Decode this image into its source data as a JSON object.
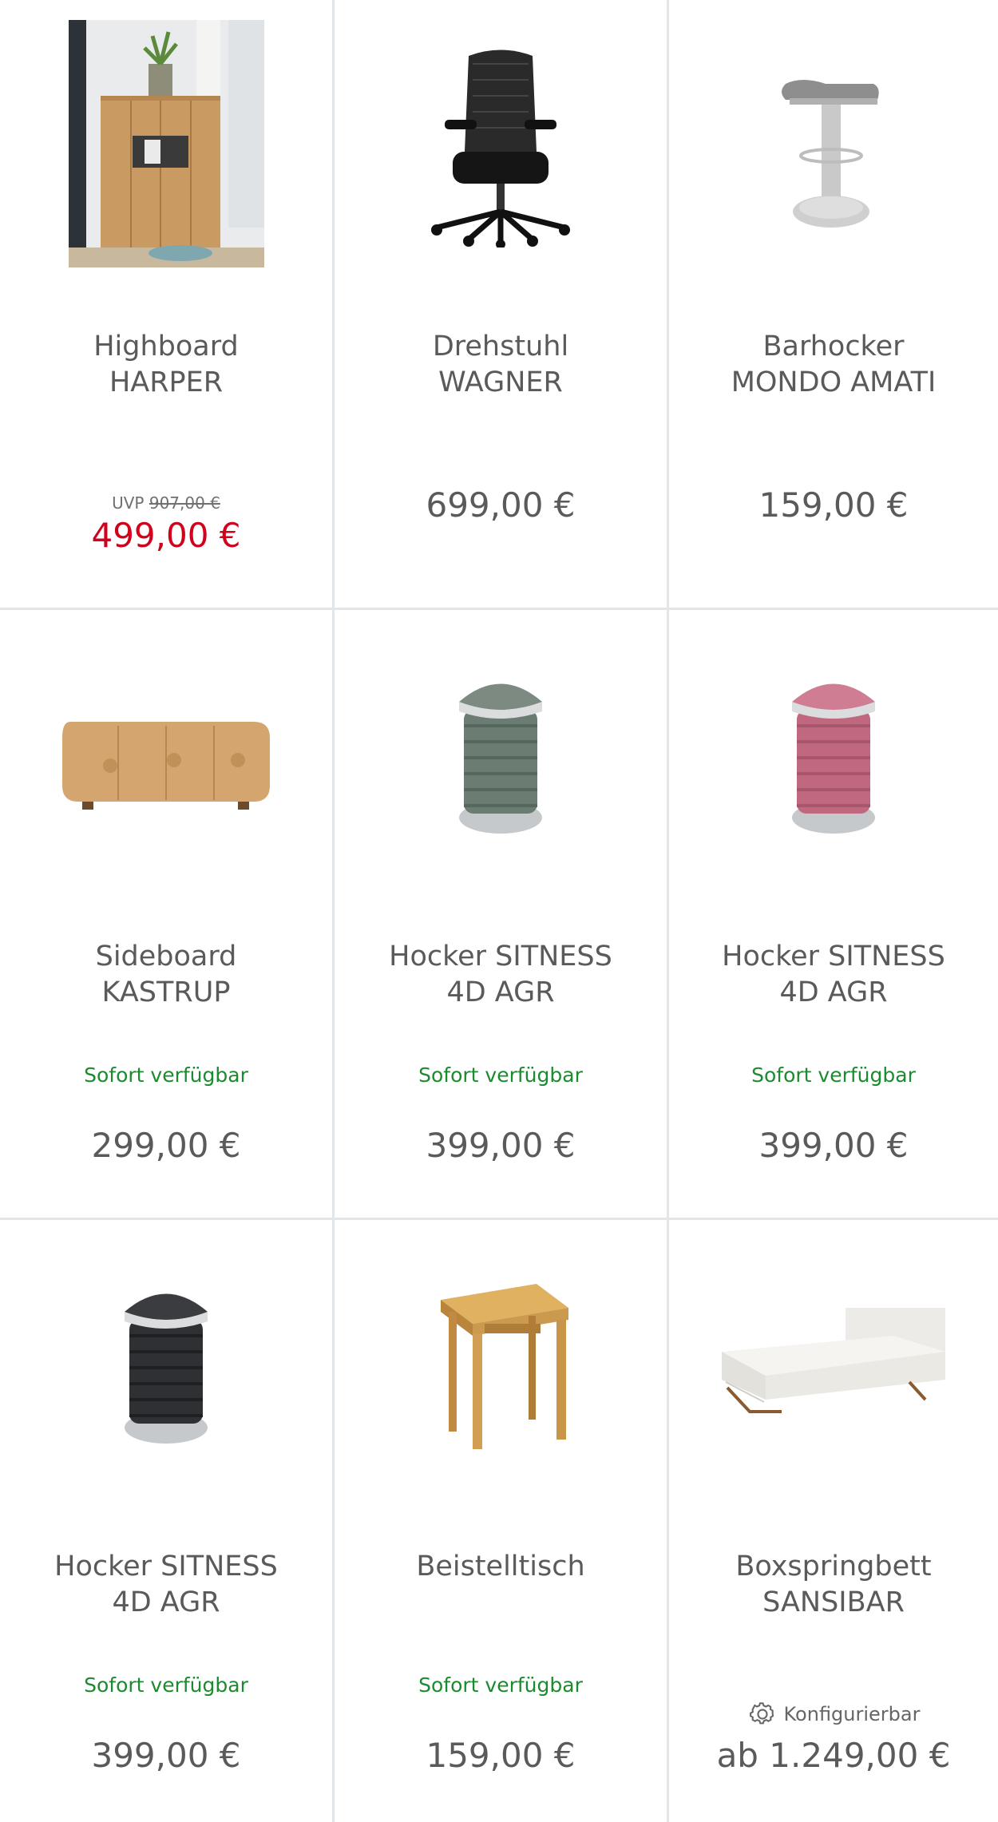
{
  "products": [
    {
      "line1": "Highboard",
      "line2": "HARPER",
      "uvp_label": "UVP",
      "uvp_old": "907,00 €",
      "price": "499,00 €",
      "image": "highboard"
    },
    {
      "line1": "Drehstuhl",
      "line2": "WAGNER",
      "price": "699,00 €",
      "image": "office-chair"
    },
    {
      "line1": "Barhocker",
      "line2": "MONDO AMATI",
      "price": "159,00 €",
      "image": "bar-stool"
    },
    {
      "line1": "Sideboard",
      "line2": "KASTRUP",
      "status": "Sofort verfügbar",
      "price": "299,00 €",
      "image": "sideboard"
    },
    {
      "line1": "Hocker SITNESS",
      "line2": "4D AGR",
      "status": "Sofort verfügbar",
      "price": "399,00 €",
      "image": "stool-grey"
    },
    {
      "line1": "Hocker SITNESS",
      "line2": "4D AGR",
      "status": "Sofort verfügbar",
      "price": "399,00 €",
      "image": "stool-pink"
    },
    {
      "line1": "Hocker SITNESS",
      "line2": "4D AGR",
      "status": "Sofort verfügbar",
      "price": "399,00 €",
      "image": "stool-black"
    },
    {
      "line1": "Beistelltisch",
      "line2": "",
      "status": "Sofort verfügbar",
      "price": "159,00 €",
      "image": "side-table"
    },
    {
      "line1": "Boxspringbett",
      "line2": "SANSIBAR",
      "config_label": "Konfigurierbar",
      "price": "ab 1.249,00 €",
      "image": "boxspring-bed"
    }
  ],
  "colors": {
    "sale_price": "#d0021b",
    "availability": "#1c8a2e",
    "text": "#5a5a5a",
    "divider": "#e3e6e8"
  }
}
